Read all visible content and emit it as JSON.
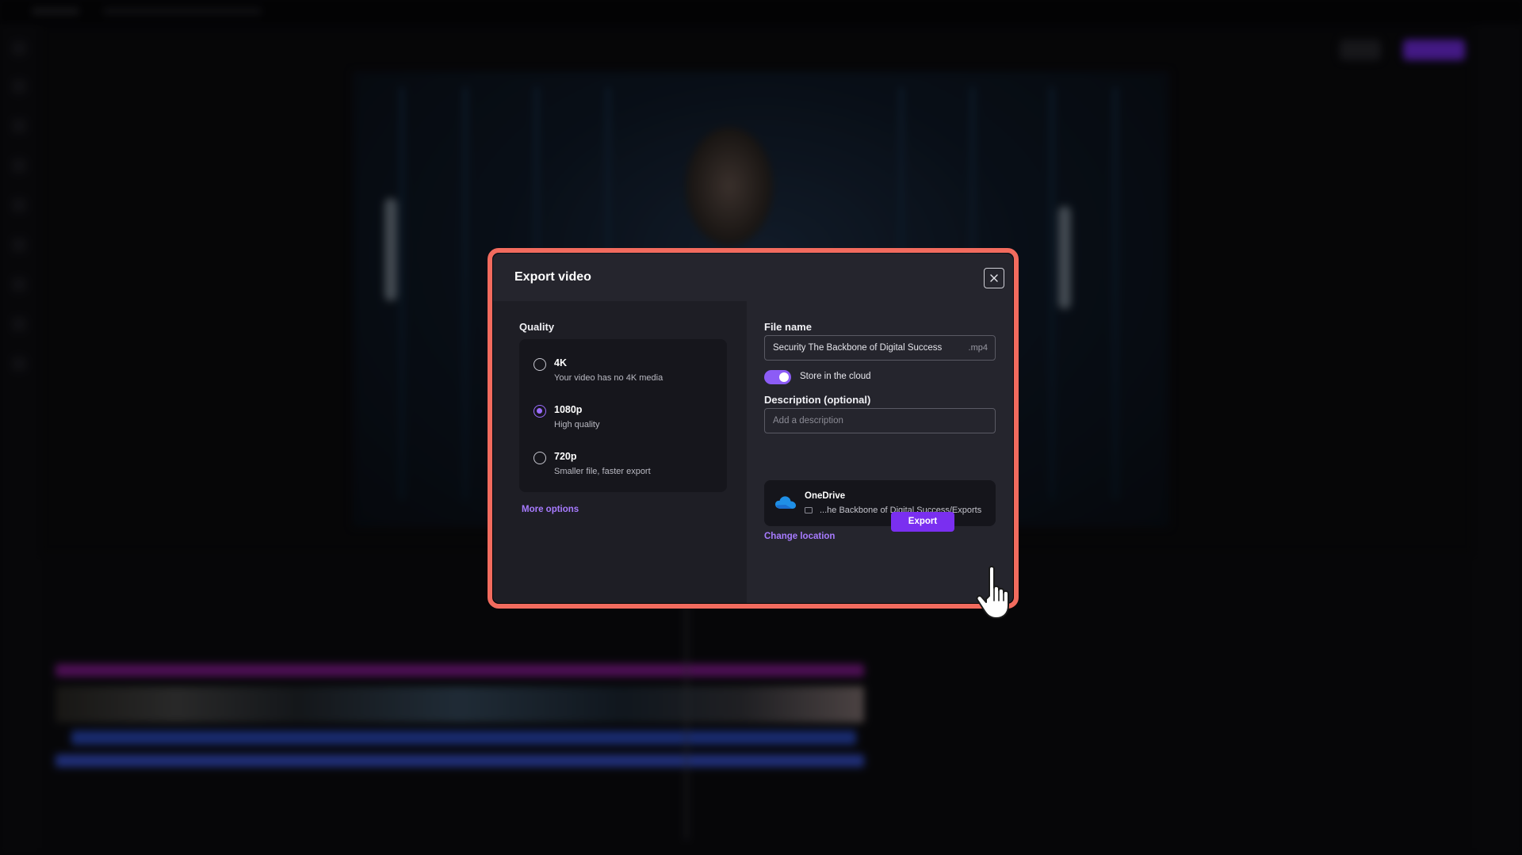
{
  "dialog": {
    "title": "Export video",
    "close_icon": "close-icon",
    "quality": {
      "label": "Quality",
      "options": [
        {
          "title": "4K",
          "subtitle": "Your video has no 4K media",
          "selected": false
        },
        {
          "title": "1080p",
          "subtitle": "High quality",
          "selected": true
        },
        {
          "title": "720p",
          "subtitle": "Smaller file, faster export",
          "selected": false
        }
      ],
      "more_options": "More options"
    },
    "file_name": {
      "label": "File name",
      "value": "Security The Backbone of Digital Success",
      "extension": ".mp4"
    },
    "store_in_cloud": {
      "label": "Store in the cloud",
      "enabled": true
    },
    "description": {
      "label": "Description (optional)",
      "placeholder": "Add a description"
    },
    "location": {
      "service": "OneDrive",
      "service_icon": "onedrive-cloud-icon",
      "path": "...he Backbone of Digital Success/Exports",
      "change_label": "Change location"
    },
    "export_label": "Export"
  },
  "colors": {
    "accent": "#7a2ff0",
    "highlight_border": "#f26b5e",
    "link": "#a77bff"
  }
}
